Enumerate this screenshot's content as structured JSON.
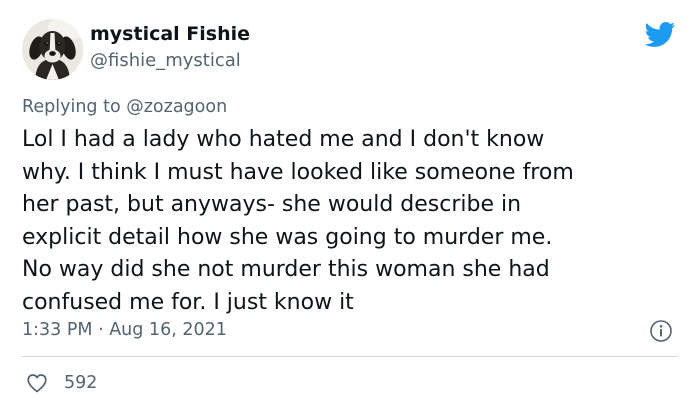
{
  "author": {
    "display_name": "mystical Fishie",
    "handle": "@fishie_mystical",
    "avatar_icon": "dog-avatar"
  },
  "reply": {
    "prefix": "Replying to",
    "target": "@zozagoon"
  },
  "tweet": {
    "lines": [
      "Lol I had a lady who hated me and I don't know",
      "why. I think I must have looked like someone from",
      "her past, but anyways- she would describe in",
      "explicit detail how she was going to murder me.",
      "No way did she not murder this woman she had",
      "confused me for. I just know it"
    ],
    "timestamp": "1:33 PM · Aug 16, 2021"
  },
  "stats": {
    "likes": "592"
  },
  "icons": {
    "brand": "twitter-bird-icon",
    "info": "info-icon",
    "like": "heart-icon"
  },
  "colors": {
    "brand_blue": "#1d9bf0",
    "text_primary": "#0f1419",
    "text_secondary": "#536471",
    "divider": "#cfd9de"
  }
}
